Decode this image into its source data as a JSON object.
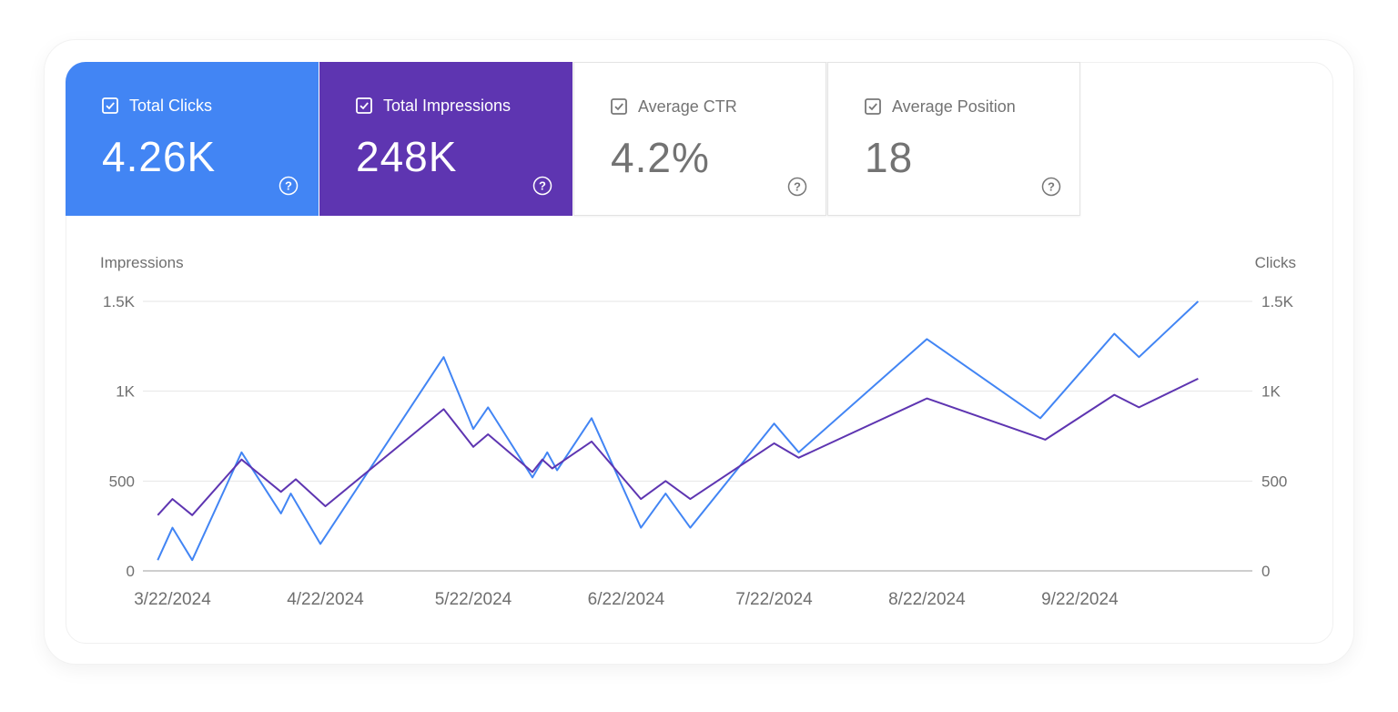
{
  "metrics": [
    {
      "label": "Total Clicks",
      "value": "4.26K",
      "checked": true,
      "color": "#4285f4"
    },
    {
      "label": "Total Impressions",
      "value": "248K",
      "checked": true,
      "color": "#5e35b1"
    },
    {
      "label": "Average CTR",
      "value": "4.2%",
      "checked": true
    },
    {
      "label": "Average Position",
      "value": "18",
      "checked": true
    }
  ],
  "help_icon": "question-circle-icon",
  "check_icon": "checkbox-checked-icon",
  "chart_data": {
    "type": "line",
    "left_axis_label": "Impressions",
    "right_axis_label": "Clicks",
    "y_ticks": [
      "0",
      "500",
      "1K",
      "1.5K"
    ],
    "y_tick_values": [
      0,
      500,
      1000,
      1500
    ],
    "ylim": [
      0,
      1500
    ],
    "x_tick_labels": [
      "3/22/2024",
      "4/22/2024",
      "5/22/2024",
      "6/22/2024",
      "7/22/2024",
      "8/22/2024",
      "9/22/2024"
    ],
    "x_tick_positions": [
      "2024-03-22",
      "2024-04-22",
      "2024-05-22",
      "2024-06-22",
      "2024-07-22",
      "2024-08-22",
      "2024-09-22"
    ],
    "x_range": [
      "2024-03-16",
      "2024-10-27"
    ],
    "grid": true,
    "series": [
      {
        "axis": "right",
        "color": "#4285f4",
        "points": [
          [
            "2024-03-19",
            60
          ],
          [
            "2024-03-22",
            240
          ],
          [
            "2024-03-26",
            60
          ],
          [
            "2024-04-05",
            660
          ],
          [
            "2024-04-13",
            320
          ],
          [
            "2024-04-15",
            430
          ],
          [
            "2024-04-21",
            150
          ],
          [
            "2024-05-16",
            1190
          ],
          [
            "2024-05-22",
            790
          ],
          [
            "2024-05-25",
            910
          ],
          [
            "2024-06-03",
            520
          ],
          [
            "2024-06-06",
            660
          ],
          [
            "2024-06-08",
            560
          ],
          [
            "2024-06-15",
            850
          ],
          [
            "2024-06-25",
            240
          ],
          [
            "2024-06-30",
            430
          ],
          [
            "2024-07-05",
            240
          ],
          [
            "2024-07-22",
            820
          ],
          [
            "2024-07-27",
            660
          ],
          [
            "2024-08-22",
            1290
          ],
          [
            "2024-09-14",
            850
          ],
          [
            "2024-09-29",
            1320
          ],
          [
            "2024-10-04",
            1190
          ],
          [
            "2024-10-16",
            1500
          ]
        ]
      },
      {
        "axis": "left",
        "color": "#5e35b1",
        "points": [
          [
            "2024-03-19",
            310
          ],
          [
            "2024-03-22",
            400
          ],
          [
            "2024-03-26",
            310
          ],
          [
            "2024-04-05",
            620
          ],
          [
            "2024-04-13",
            440
          ],
          [
            "2024-04-16",
            510
          ],
          [
            "2024-04-22",
            360
          ],
          [
            "2024-05-16",
            900
          ],
          [
            "2024-05-22",
            690
          ],
          [
            "2024-05-25",
            760
          ],
          [
            "2024-06-03",
            550
          ],
          [
            "2024-06-05",
            620
          ],
          [
            "2024-06-07",
            570
          ],
          [
            "2024-06-15",
            720
          ],
          [
            "2024-06-25",
            400
          ],
          [
            "2024-06-30",
            500
          ],
          [
            "2024-07-05",
            400
          ],
          [
            "2024-07-22",
            710
          ],
          [
            "2024-07-27",
            630
          ],
          [
            "2024-08-22",
            960
          ],
          [
            "2024-09-15",
            730
          ],
          [
            "2024-09-29",
            980
          ],
          [
            "2024-10-04",
            910
          ],
          [
            "2024-10-16",
            1070
          ]
        ]
      }
    ]
  }
}
